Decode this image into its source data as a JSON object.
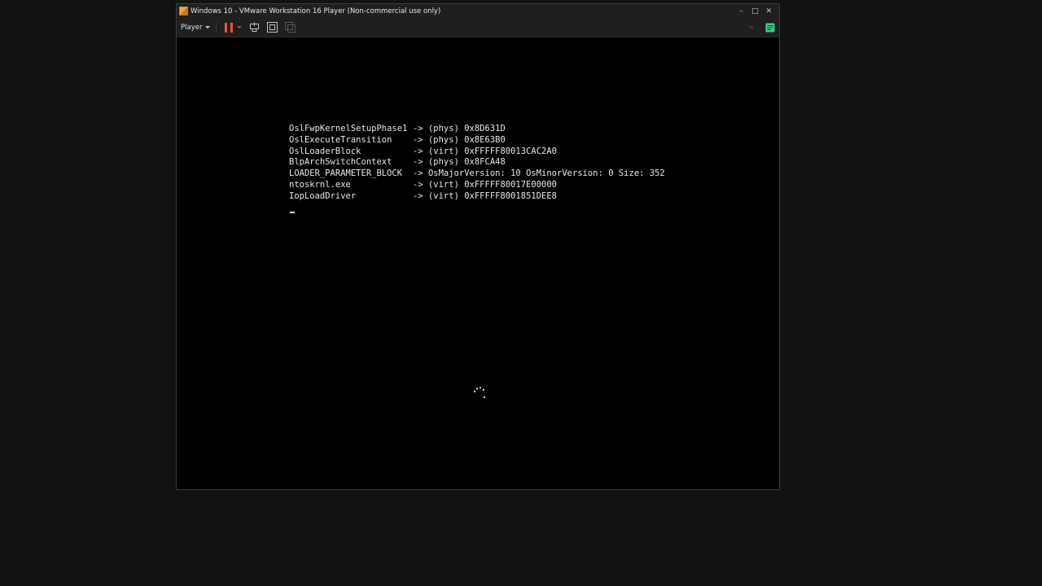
{
  "window": {
    "title": "Windows 10 - VMware Workstation 16 Player (Non-commercial use only)",
    "controls": {
      "minimize": "–",
      "maximize": "□",
      "close": "✕"
    }
  },
  "toolbar": {
    "player_menu": "Player",
    "back_arrows": "«",
    "icons": [
      "pause-icon",
      "send-ctrl-alt-del-icon",
      "fullscreen-icon",
      "unity-icon",
      "notes-icon"
    ],
    "accent_color": "#e4572e",
    "notes_color": "#3fd08a"
  },
  "boot_log": [
    {
      "name": "OslFwpKernelSetupPhase1",
      "value": "-> (phys) 0x8D631D"
    },
    {
      "name": "OslExecuteTransition",
      "value": "-> (phys) 0x8E63B0"
    },
    {
      "name": "OslLoaderBlock",
      "value": "-> (virt) 0xFFFFF80013CAC2A0"
    },
    {
      "name": "BlpArchSwitchContext",
      "value": "-> (phys) 0x8FCA48"
    },
    {
      "name": "LOADER_PARAMETER_BLOCK",
      "value": "-> OsMajorVersion: 10 OsMinorVersion: 0 Size: 352"
    },
    {
      "name": "ntoskrnl.exe",
      "value": "-> (virt) 0xFFFFF80017E00000"
    },
    {
      "name": "IopLoadDriver",
      "value": "-> (virt) 0xFFFFF8001851DEE8"
    }
  ]
}
